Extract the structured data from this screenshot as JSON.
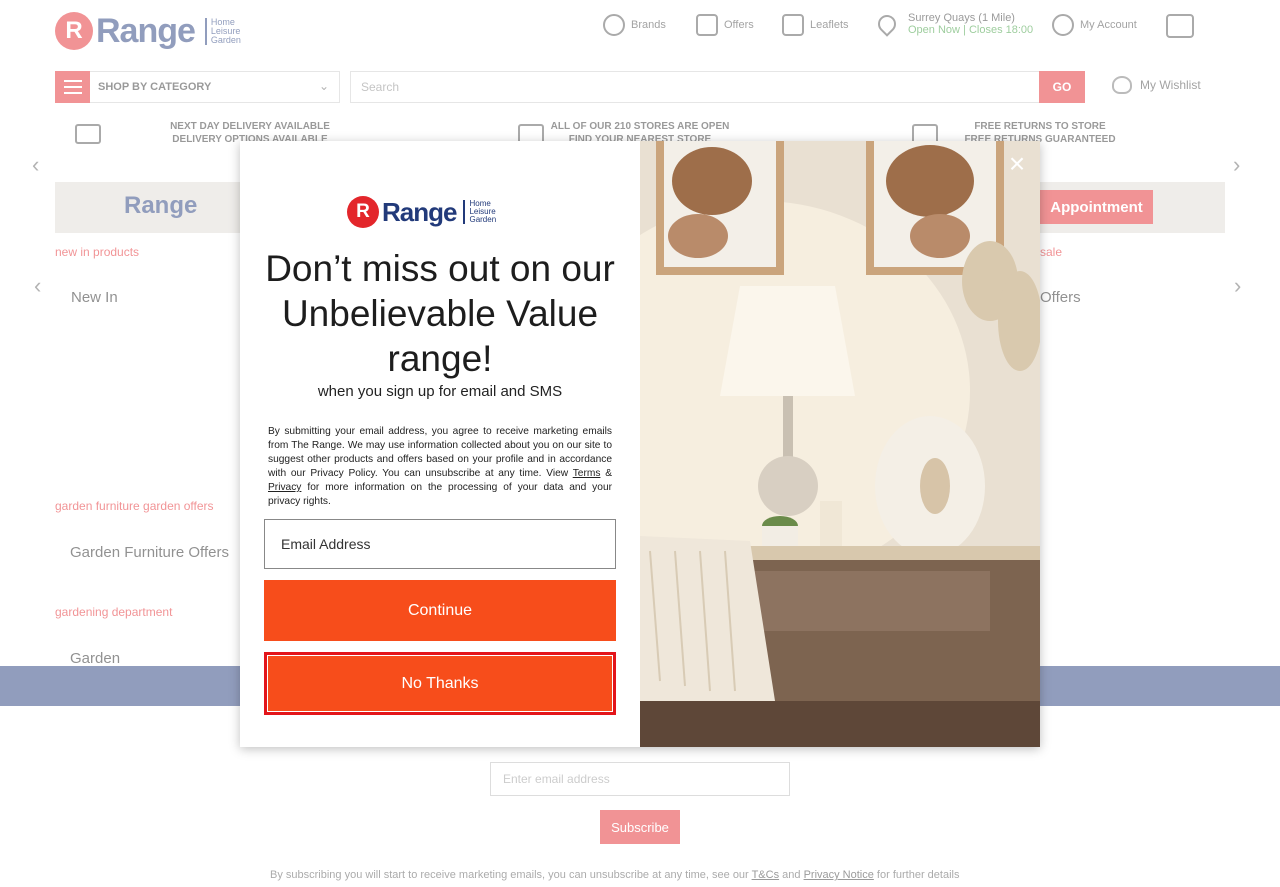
{
  "header": {
    "logo_letter": "R",
    "logo_word": "Range",
    "logo_tagline": "Home Leisure Garden",
    "nav": {
      "brands": "Brands",
      "offers": "Offers",
      "leaflets": "Leaflets",
      "store_name": "Surrey Quays (1 Mile)",
      "store_status": "Open Now | Closes 18:00",
      "account": "My Account"
    }
  },
  "toolbar": {
    "category_label": "SHOP BY CATEGORY",
    "search_placeholder": "Search",
    "search_go": "GO",
    "wishlist": "My Wishlist"
  },
  "usps": [
    {
      "line1": "NEXT DAY DELIVERY AVAILABLE",
      "line2": "DELIVERY OPTIONS AVAILABLE"
    },
    {
      "line1": "ALL OF OUR 210 STORES ARE OPEN",
      "line2": "FIND YOUR NEAREST STORE"
    },
    {
      "line1": "FREE RETURNS TO STORE",
      "line2": "FREE RETURNS GUARANTEED"
    }
  ],
  "banner": {
    "logo": "Range",
    "cta": "Appointment"
  },
  "sections": [
    {
      "link": "new in products",
      "title": "New In"
    },
    {
      "link": "sale",
      "title": "Offers"
    },
    {
      "link": "garden furniture garden offers",
      "title": "Garden Furniture Offers"
    },
    {
      "link": "gardening department",
      "title": "Garden"
    }
  ],
  "footer": {
    "email_placeholder": "Enter email address",
    "subscribe": "Subscribe",
    "note_prefix": "By subscribing you will start to receive marketing emails, you can unsubscribe at any time, see our",
    "note_tcs": "T&Cs",
    "note_and": "and",
    "note_privacy": "Privacy Notice",
    "note_suffix": "for further details"
  },
  "modal": {
    "logo_letter": "R",
    "logo_word": "Range",
    "logo_tagline": "Home Leisure Garden",
    "heading": "Don’t miss out on our Unbelievable Value range!",
    "subheading": "when you sign up for email and SMS",
    "legal_before_terms": "By submitting your email address, you agree to receive marketing emails from The Range. We may use information collected about you on our site to suggest other products and offers based on your profile and in accordance with our Privacy Policy. You can unsubscribe at any time. View",
    "legal_terms": "Terms",
    "legal_amp": "&",
    "legal_privacy": "Privacy",
    "legal_after": "for more information on the processing of your data and your privacy rights.",
    "email_placeholder": "Email Address",
    "continue": "Continue",
    "no_thanks": "No Thanks",
    "close_icon": "close-icon",
    "accent_color": "#f74d1b"
  }
}
